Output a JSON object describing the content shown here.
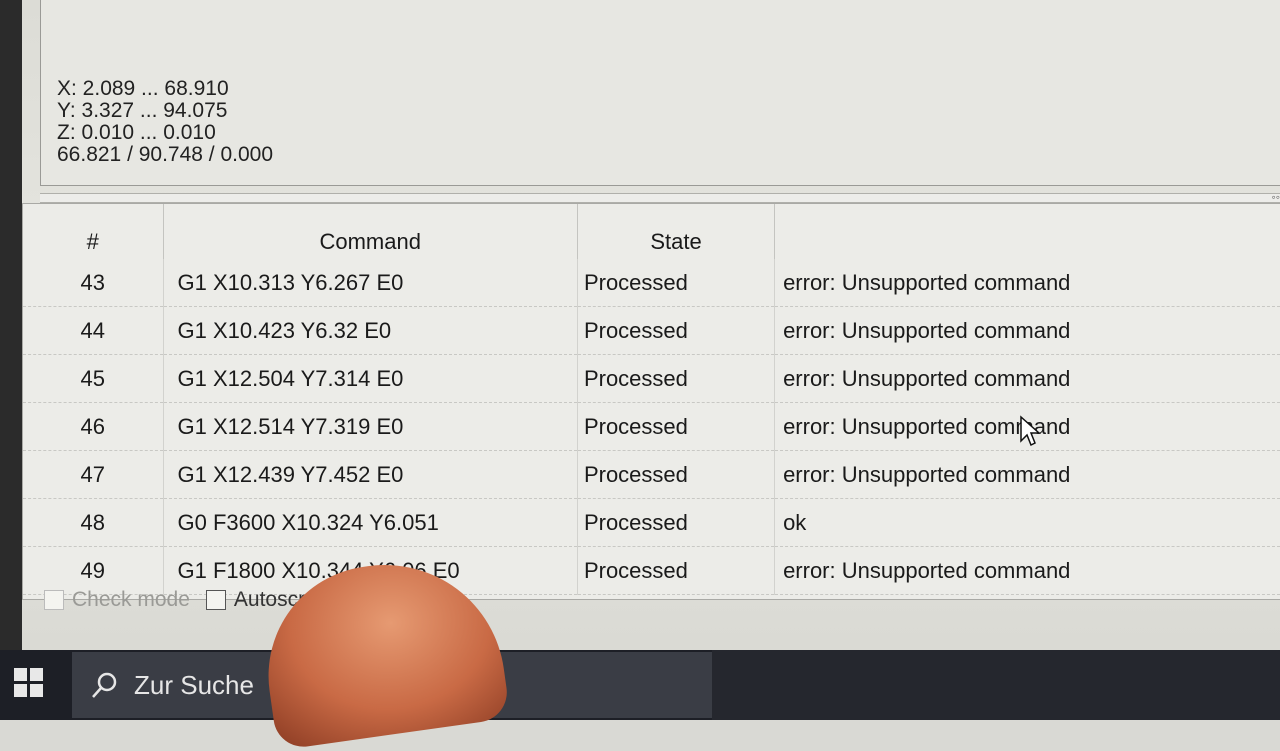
{
  "coordinates": {
    "x_range": "X: 2.089 ... 68.910",
    "y_range": "Y: 3.327 ... 94.075",
    "z_range": "Z: 0.010 ... 0.010",
    "position": "66.821 / 90.748 / 0.000"
  },
  "console_table": {
    "headers": {
      "number": "#",
      "command": "Command",
      "state": "State",
      "response": ""
    },
    "rows": [
      {
        "number": "43",
        "command": "G1 X10.313 Y6.267 E0",
        "state": "Processed",
        "response": "error: Unsupported command"
      },
      {
        "number": "44",
        "command": "G1 X10.423 Y6.32 E0",
        "state": "Processed",
        "response": "error: Unsupported command"
      },
      {
        "number": "45",
        "command": "G1 X12.504 Y7.314 E0",
        "state": "Processed",
        "response": "error: Unsupported command"
      },
      {
        "number": "46",
        "command": "G1 X12.514 Y7.319 E0",
        "state": "Processed",
        "response": "error: Unsupported command"
      },
      {
        "number": "47",
        "command": "G1 X12.439 Y7.452 E0",
        "state": "Processed",
        "response": "error: Unsupported command"
      },
      {
        "number": "48",
        "command": "G0 F3600 X10.324 Y6.051",
        "state": "Processed",
        "response": "ok"
      },
      {
        "number": "49",
        "command": "G1 F1800 X10.344 Y6.06 E0",
        "state": "Processed",
        "response": "error: Unsupported command"
      }
    ]
  },
  "options": {
    "check_mode_label": "Check mode",
    "autoscroll_label": "Autoscroll"
  },
  "taskbar": {
    "search_text": "Zur Suche",
    "icons": [
      "windows-start-icon",
      "search-icon"
    ]
  }
}
